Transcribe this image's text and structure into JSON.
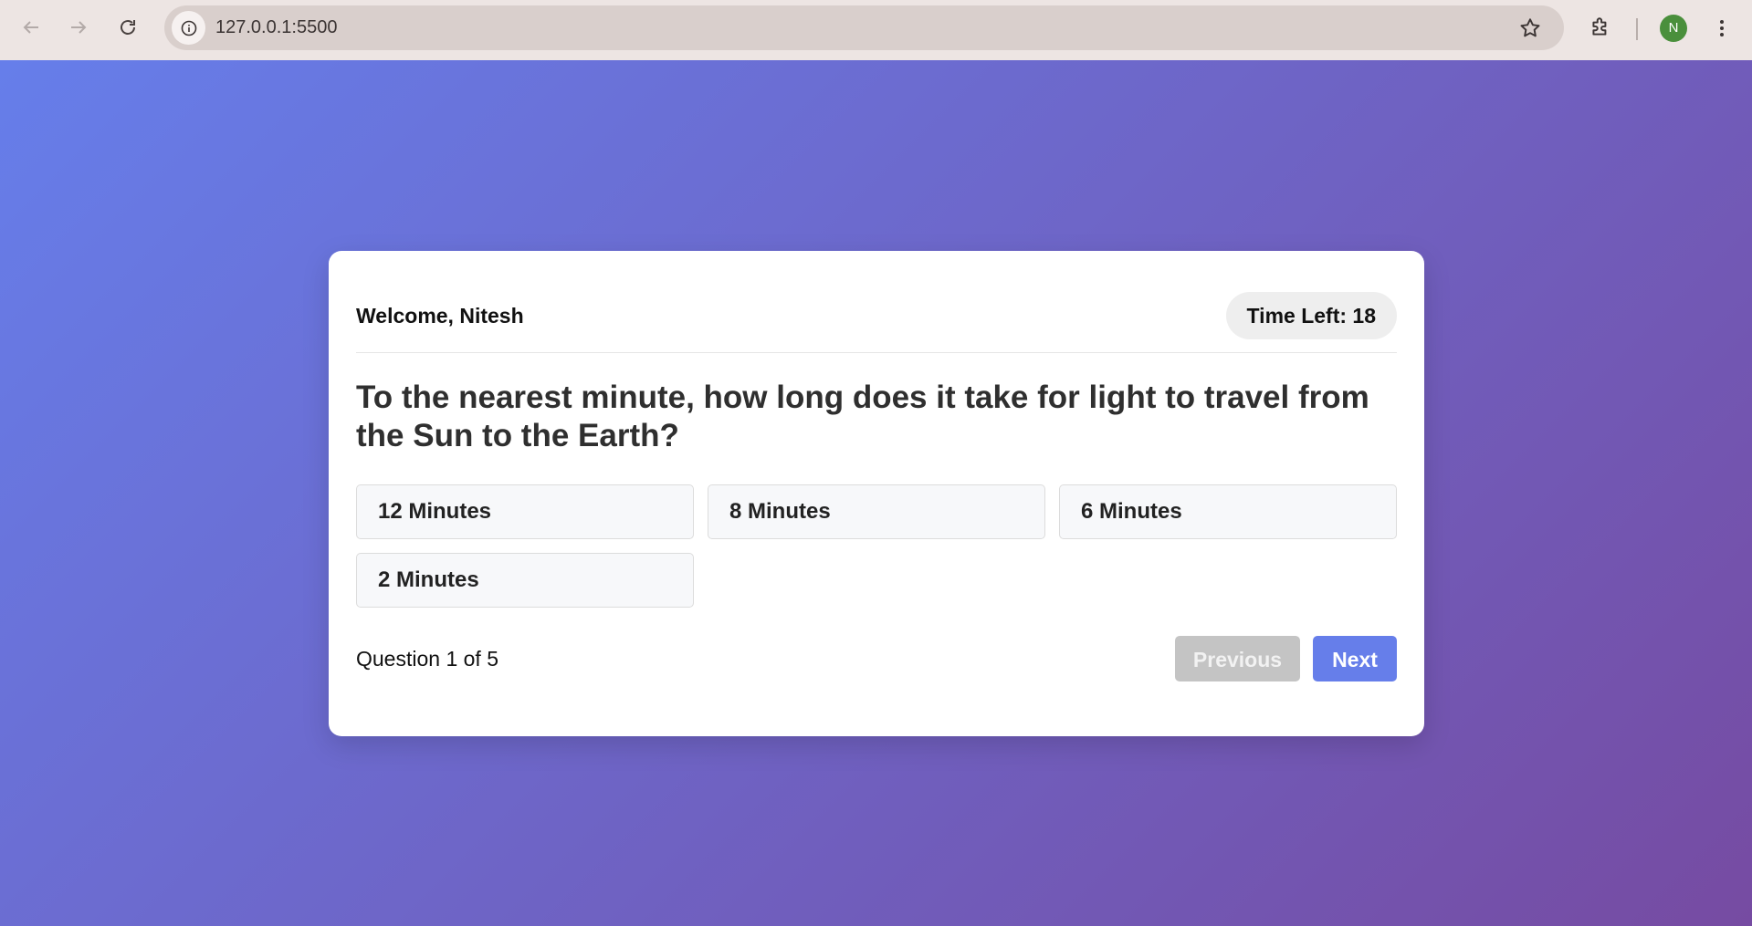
{
  "browser": {
    "url": "127.0.0.1:5500",
    "profile_initial": "N",
    "icons": [
      "back-arrow-icon",
      "forward-arrow-icon",
      "reload-icon",
      "info-icon",
      "star-icon",
      "extensions-icon",
      "more-vertical-icon"
    ]
  },
  "colors": {
    "gradient_start": "#667eea",
    "gradient_end": "#764ba2",
    "next_button": "#667eea",
    "prev_button_disabled": "#c4c4c4"
  },
  "quiz": {
    "welcome": "Welcome, Nitesh",
    "timer": "Time Left: 18",
    "question": "To the nearest minute, how long does it take for light to travel from the Sun to the Earth?",
    "options": [
      "12 Minutes",
      "8 Minutes",
      "6 Minutes",
      "2 Minutes"
    ],
    "progress": "Question 1 of 5",
    "previous_label": "Previous",
    "next_label": "Next"
  }
}
